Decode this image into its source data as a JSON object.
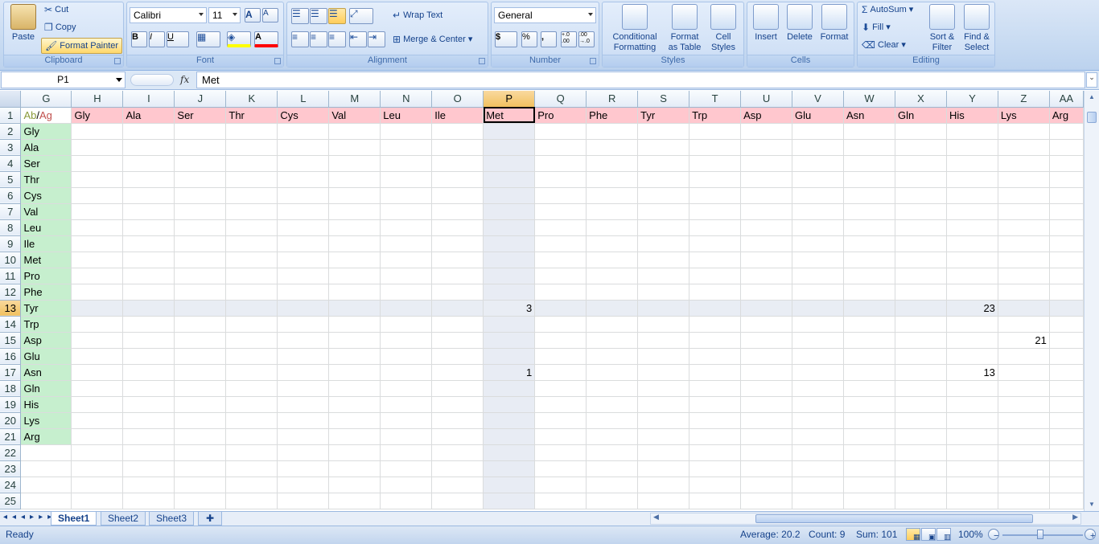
{
  "ribbon": {
    "clipboard": {
      "paste": "Paste",
      "cut": "Cut",
      "copy": "Copy",
      "format_painter": "Format Painter",
      "label": "Clipboard"
    },
    "font": {
      "name": "Calibri",
      "size": "11",
      "label": "Font",
      "bold": "B",
      "italic": "I",
      "underline": "U",
      "grow": "A",
      "shrink": "A",
      "font_color": "A"
    },
    "alignment": {
      "wrap_text": "Wrap Text",
      "merge_center": "Merge & Center",
      "label": "Alignment"
    },
    "number": {
      "format": "General",
      "currency": "$",
      "percent": "%",
      "comma": ",",
      "inc_decimal": "+.0\n.00",
      "dec_decimal": ".00\n→.0",
      "label": "Number"
    },
    "styles": {
      "conditional": "Conditional",
      "conditional2": "Formatting",
      "format_table": "Format",
      "format_table2": "as Table",
      "cell_styles": "Cell",
      "cell_styles2": "Styles",
      "label": "Styles"
    },
    "cells": {
      "insert": "Insert",
      "delete": "Delete",
      "format": "Format",
      "label": "Cells"
    },
    "editing": {
      "autosum": "AutoSum",
      "fill": "Fill",
      "clear": "Clear",
      "sort": "Sort &",
      "sort2": "Filter",
      "find": "Find &",
      "find2": "Select",
      "label": "Editing"
    }
  },
  "formula_bar": {
    "name_box": "P1",
    "fx": "fx",
    "formula": "Met"
  },
  "grid": {
    "columns": [
      "G",
      "H",
      "I",
      "J",
      "K",
      "L",
      "M",
      "N",
      "O",
      "P",
      "Q",
      "R",
      "S",
      "T",
      "U",
      "V",
      "W",
      "X",
      "Y",
      "Z",
      "AA"
    ],
    "selected_col": "P",
    "selected_row": "13",
    "corner_ab": "Ab",
    "corner_slash": "/",
    "corner_ag": "Ag",
    "header_row": [
      "Gly",
      "Ala",
      "Ser",
      "Thr",
      "Cys",
      "Val",
      "Leu",
      "Ile",
      "Met",
      "Pro",
      "Phe",
      "Tyr",
      "Trp",
      "Asp",
      "Glu",
      "Asn",
      "Gln",
      "His",
      "Lys",
      "Arg"
    ],
    "row_labels": [
      "Gly",
      "Ala",
      "Ser",
      "Thr",
      "Cys",
      "Val",
      "Leu",
      "Ile",
      "Met",
      "Pro",
      "Phe",
      "Tyr",
      "Trp",
      "Asp",
      "Glu",
      "Asn",
      "Gln",
      "His",
      "Lys",
      "Arg"
    ],
    "row_numbers": [
      "1",
      "2",
      "3",
      "4",
      "5",
      "6",
      "7",
      "8",
      "9",
      "10",
      "11",
      "12",
      "13",
      "14",
      "15",
      "16",
      "17",
      "18",
      "19",
      "20",
      "21",
      "22",
      "23",
      "24",
      "25"
    ],
    "values": {
      "r13_P": "3",
      "r13_Y": "23",
      "r15_Z": "21",
      "r17_P": "1",
      "r17_Y": "13"
    }
  },
  "sheets": {
    "tabs": [
      "Sheet1",
      "Sheet2",
      "Sheet3"
    ],
    "active": "Sheet1",
    "nav": "◂◂◂▸▸▸"
  },
  "status": {
    "ready": "Ready",
    "average": "Average: 20.2",
    "count": "Count: 9",
    "sum": "Sum: 101",
    "zoom": "100%"
  },
  "colors": {
    "header_fill": "#ffc7ce",
    "header_text": "#9c0006",
    "label_fill": "#c6efce",
    "label_text": "#006100"
  }
}
